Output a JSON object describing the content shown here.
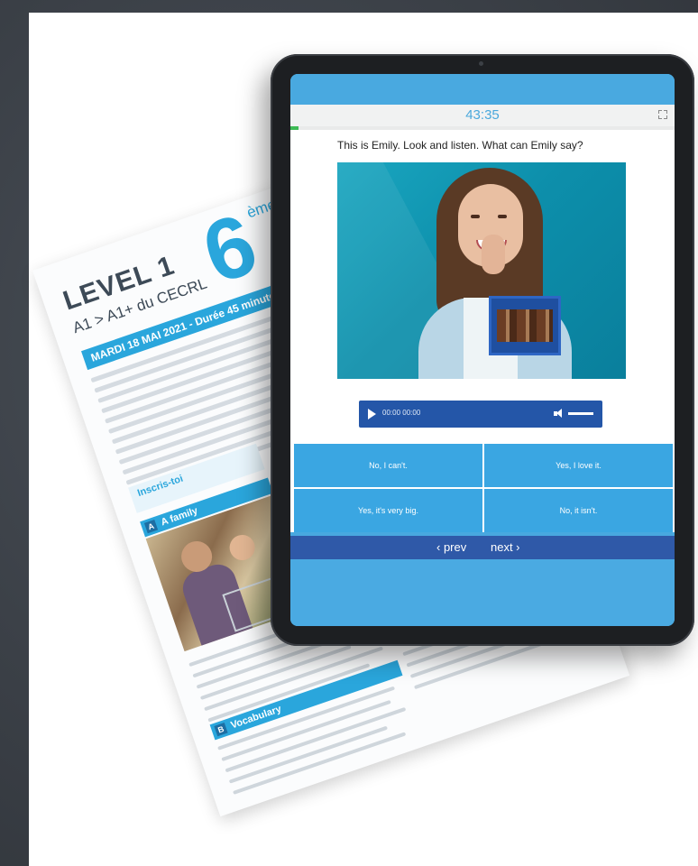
{
  "paper": {
    "level": "LEVEL 1",
    "cecrl": "A1 > A1+ du CECRL",
    "grade_number": "6",
    "grade_suffix": "ème",
    "date_band": "MARDI 18 MAI 2021 - Durée 45 minutes",
    "tip": "Inscris-toi",
    "section_a": "A family",
    "section_a_num": "A",
    "section_b": "Vocabulary",
    "section_b_num": "B"
  },
  "quiz": {
    "timer": "43:35",
    "progress_percent": 2,
    "question": "This is Emily. Look and listen. What can Emily say?",
    "audio_time": "00:00 00:00",
    "answers": [
      "No, I can't.",
      "Yes, I love it.",
      "Yes, it's very big.",
      "No, it isn't."
    ],
    "prev_label": "‹ prev",
    "next_label": "next ›"
  },
  "colors": {
    "accent": "#48a8df",
    "answer": "#3aa6e2",
    "nav": "#2f59a8",
    "progress": "#3dbb55"
  }
}
